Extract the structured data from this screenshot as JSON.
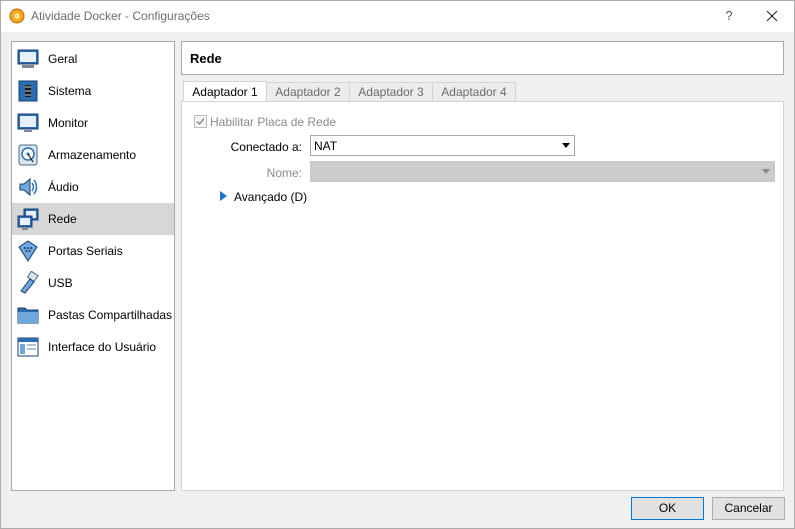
{
  "window": {
    "title": "Atividade Docker - Configurações",
    "help_label": "?"
  },
  "sidebar": {
    "items": [
      {
        "label": "Geral",
        "icon": "general-monitor-icon"
      },
      {
        "label": "Sistema",
        "icon": "system-chip-icon"
      },
      {
        "label": "Monitor",
        "icon": "display-icon"
      },
      {
        "label": "Armazenamento",
        "icon": "storage-disk-icon"
      },
      {
        "label": "Áudio",
        "icon": "speaker-icon"
      },
      {
        "label": "Rede",
        "icon": "network-icon",
        "selected": true
      },
      {
        "label": "Portas Seriais",
        "icon": "serial-port-icon"
      },
      {
        "label": "USB",
        "icon": "usb-icon"
      },
      {
        "label": "Pastas Compartilhadas",
        "icon": "shared-folder-icon"
      },
      {
        "label": "Interface do Usuário",
        "icon": "user-interface-icon"
      }
    ]
  },
  "page": {
    "title": "Rede"
  },
  "tabs": [
    {
      "label": "Adaptador 1",
      "active": true
    },
    {
      "label": "Adaptador 2"
    },
    {
      "label": "Adaptador 3"
    },
    {
      "label": "Adaptador 4"
    }
  ],
  "adapter": {
    "enable_label": "Habilitar Placa de Rede",
    "enable_checked": true,
    "attached_label": "Conectado a:",
    "attached_value": "NAT",
    "name_label": "Nome:",
    "name_value": "",
    "advanced_label": "Avançado (D)"
  },
  "buttons": {
    "ok": "OK",
    "cancel": "Cancelar"
  },
  "colors": {
    "selection": "#d7d7d7",
    "accent": "#1e73c8"
  }
}
